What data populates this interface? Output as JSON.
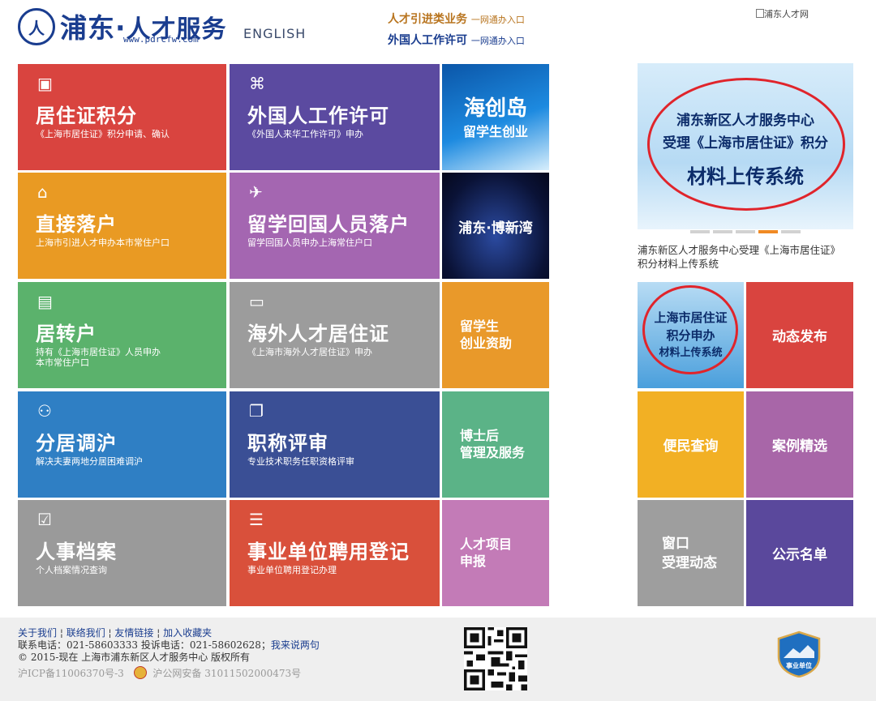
{
  "header": {
    "logo_mark": "人",
    "logo_name": "浦东",
    "logo_sub": "人才服务",
    "logo_url": "www.pdrcfw.com",
    "english": "ENGLISH",
    "link1": {
      "label": "人才引进类业务",
      "tail": "一网通办入口"
    },
    "link2": {
      "label": "外国人工作许可",
      "tail": "一网通办入口"
    },
    "topright": "浦东人才网"
  },
  "tiles": [
    {
      "title": "居住证积分",
      "subtitle": "《上海市居住证》积分申请、确认",
      "color": "#d9443f"
    },
    {
      "title": "外国人工作许可",
      "subtitle": "《外国人来华工作许可》申办",
      "color": "#5b4aa0"
    },
    {
      "title": "直接落户",
      "subtitle": "上海市引进人才申办本市常住户口",
      "color": "#e99a23"
    },
    {
      "title": "留学回国人员落户",
      "subtitle": "留学回国人员申办上海常住户口",
      "color": "#a466b1"
    },
    {
      "title": "居转户",
      "subtitle": "持有《上海市居住证》人员申办\n本市常住户口",
      "color": "#5bb26c"
    },
    {
      "title": "海外人才居住证",
      "subtitle": "《上海市海外人才居住证》申办",
      "color": "#9c9c9c"
    },
    {
      "title": "分居调沪",
      "subtitle": "解决夫妻两地分居困难调沪",
      "color": "#2f7fc4"
    },
    {
      "title": "职称评审",
      "subtitle": "专业技术职务任职资格评审",
      "color": "#3a4f95"
    },
    {
      "title": "人事档案",
      "subtitle": "个人档案情况查询",
      "color": "#9a9a9a"
    },
    {
      "title": "事业单位聘用登记",
      "subtitle": "事业单位聘用登记办理",
      "color": "#d9503b"
    }
  ],
  "small_tiles": [
    {
      "label": "海创岛",
      "label2": "留学生创业"
    },
    {
      "label": "浦东·博新湾"
    },
    {
      "label": "留学生\n创业资助",
      "color": "#e9992a"
    },
    {
      "label": "博士后\n管理及服务",
      "color": "#5bb387"
    },
    {
      "label": "人才项目\n申报",
      "color": "#c37bb7"
    }
  ],
  "banner": {
    "line1": "浦东新区人才服务中心",
    "line2": "受理《上海市居住证》积分",
    "line3": "材料上传系统",
    "caption": "浦东新区人才服务中心受理《上海市居住证》积分材料上传系统"
  },
  "right_tiles": {
    "upload": {
      "l1": "上海市居住证",
      "l2": "积分申办",
      "l3": "材料上传系统"
    },
    "news": {
      "label": "动态发布",
      "color": "#d9443f"
    },
    "query": {
      "label": "便民查询",
      "color": "#f2b024"
    },
    "cases": {
      "label": "案例精选",
      "color": "#a866a8"
    },
    "window": {
      "label": "窗口\n受理动态",
      "color": "#9e9e9e"
    },
    "publicity": {
      "label": "公示名单",
      "color": "#5a489c"
    }
  },
  "footer": {
    "links": [
      "关于我们",
      "联络我们",
      "友情链接",
      "加入收藏夹"
    ],
    "phone": "联系电话：021-58603333   投诉电话：021-58602628；",
    "feedback": "我来说两句",
    "copyright": "© 2015-现在 上海市浦东新区人才服务中心 版权所有",
    "icp": "沪ICP备11006370号-3",
    "police": "沪公网安备 31011502000473号",
    "badge": "事业单位"
  }
}
